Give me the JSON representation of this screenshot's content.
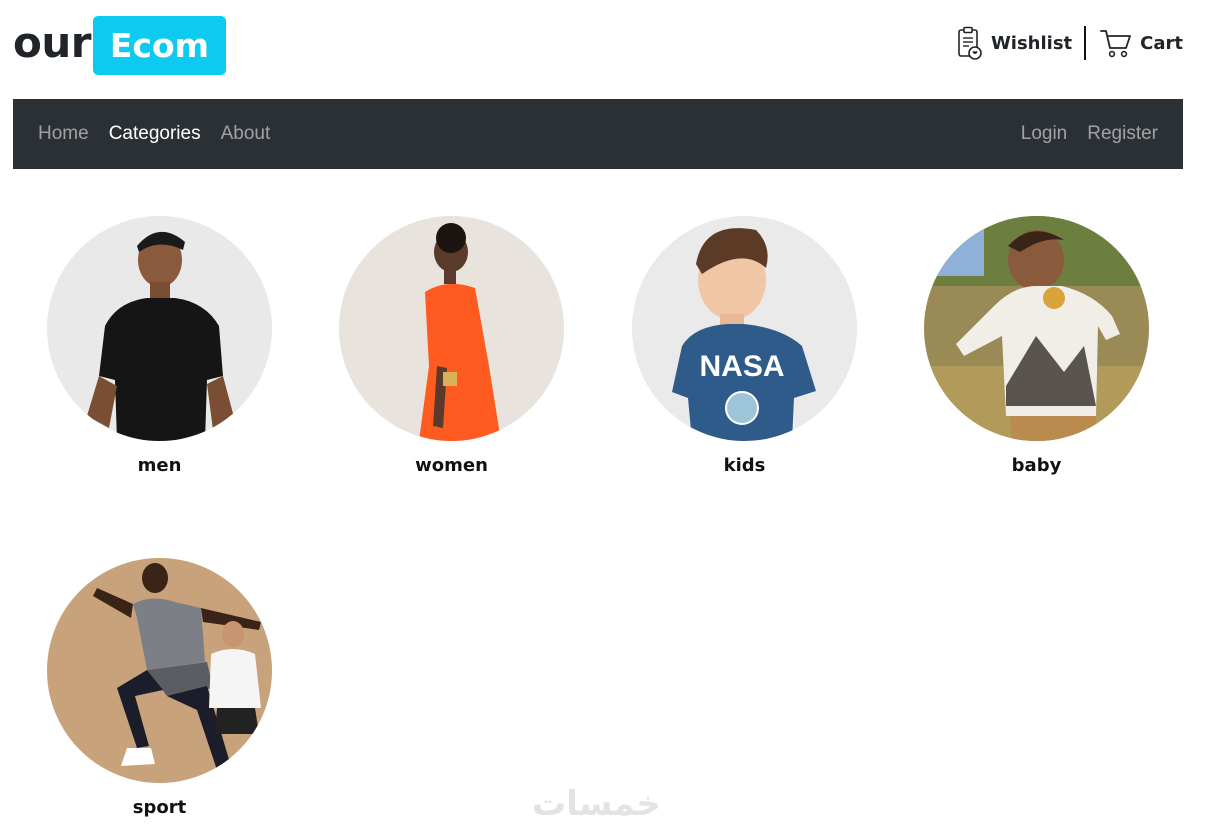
{
  "header": {
    "logo_prefix": "our",
    "logo_badge": "Ecom",
    "wishlist_label": "Wishlist",
    "cart_label": "Cart",
    "accent_color": "#0dcaf0"
  },
  "nav": {
    "left": [
      {
        "label": "Home"
      },
      {
        "label": "Categories"
      },
      {
        "label": "About"
      }
    ],
    "right": [
      {
        "label": "Login"
      },
      {
        "label": "Register"
      }
    ],
    "active": "Categories",
    "background": "#2b3035"
  },
  "categories": [
    {
      "name": "men"
    },
    {
      "name": "women"
    },
    {
      "name": "kids"
    },
    {
      "name": "baby"
    },
    {
      "name": "sport"
    }
  ],
  "watermark": "خمسات"
}
